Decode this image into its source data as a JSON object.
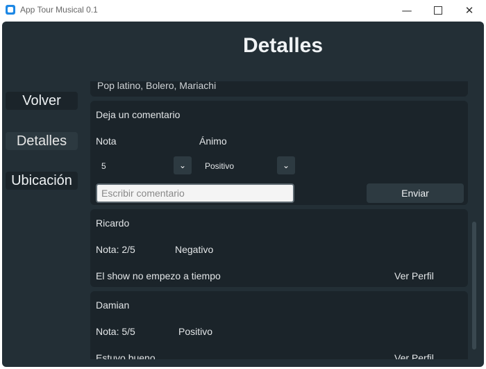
{
  "window": {
    "title": "App Tour Musical 0.1",
    "minimize_glyph": "—",
    "close_glyph": "✕"
  },
  "header": {
    "title": "Detalles"
  },
  "sidebar": {
    "items": [
      {
        "label": "Volver"
      },
      {
        "label": "Detalles",
        "active": true
      },
      {
        "label": "Ubicación"
      }
    ]
  },
  "genre": {
    "text": "Pop latino, Bolero, Mariachi"
  },
  "comment_form": {
    "heading": "Deja un comentario",
    "nota_label": "Nota",
    "animo_label": "Ánimo",
    "nota_value": "5",
    "animo_value": "Positivo",
    "input_placeholder": "Escribir comentario",
    "input_value": "",
    "send_label": "Enviar",
    "dropdown_glyph": "⌄"
  },
  "reviews": [
    {
      "user": "Ricardo",
      "nota": "Nota: 2/5",
      "mood": "Negativo",
      "text": "El show no empezo a tiempo",
      "profile_label": "Ver Perfil"
    },
    {
      "user": "Damian",
      "nota": "Nota: 5/5",
      "mood": "Positivo",
      "text": "Estuvo bueno",
      "profile_label": "Ver Perfil"
    }
  ],
  "colors": {
    "background": "#232f36",
    "panel": "#1b242a",
    "button": "#2d3a41",
    "text": "#e3e6e8"
  }
}
